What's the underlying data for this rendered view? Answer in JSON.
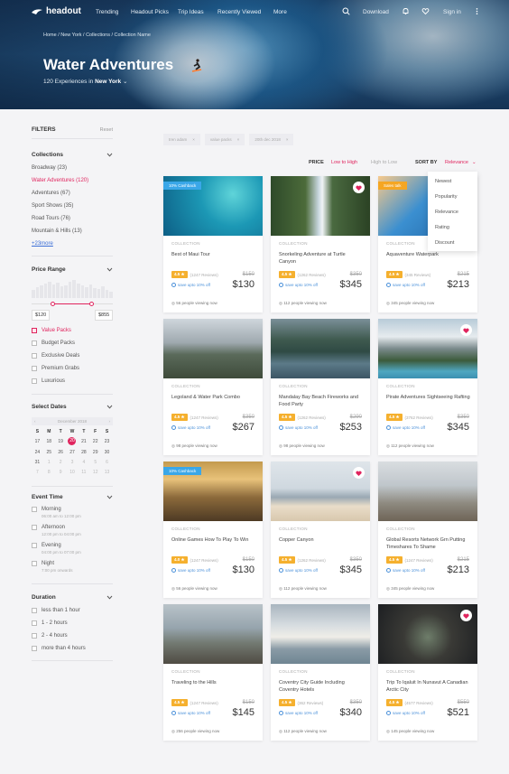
{
  "nav": {
    "brand": "headout",
    "items": [
      "Trending",
      "Headout Picks",
      "Trip Ideas",
      "Recently Viewed",
      "More"
    ],
    "download": "Download",
    "signin": "Sign in"
  },
  "hero": {
    "breadcrumb": "Home / New York / Collections / Collection Name",
    "title": "Water Adventures",
    "subtitle_prefix": "120 Experiences in",
    "city": "New York"
  },
  "filters": {
    "title": "FILTERS",
    "reset": "Reset",
    "collections_title": "Collections",
    "collections": [
      {
        "label": "Broadway (23)",
        "active": false
      },
      {
        "label": "Water Adventures (120)",
        "active": true
      },
      {
        "label": "Adventures (67)",
        "active": false
      },
      {
        "label": "Sport Shows (35)",
        "active": false
      },
      {
        "label": "Road Tours (76)",
        "active": false
      },
      {
        "label": "Mountain & Hills (13)",
        "active": false
      }
    ],
    "more": "+23more",
    "price_title": "Price Range",
    "price_min": "$120",
    "price_max": "$855",
    "price_histogram": [
      0.45,
      0.6,
      0.7,
      0.8,
      0.9,
      0.75,
      0.85,
      0.65,
      0.7,
      0.9,
      1.0,
      0.8,
      0.7,
      0.6,
      0.75,
      0.55,
      0.5,
      0.65,
      0.45,
      0.35
    ],
    "packs": [
      {
        "label": "Value Packs",
        "checked": true
      },
      {
        "label": "Budget Packs",
        "checked": false
      },
      {
        "label": "Exclusive Deals",
        "checked": false
      },
      {
        "label": "Premium Grabs",
        "checked": false
      },
      {
        "label": "Luxurious",
        "checked": false
      }
    ],
    "dates_title": "Select Dates",
    "calendar_month": "December 2018",
    "weekdays": [
      "S",
      "M",
      "T",
      "W",
      "T",
      "F",
      "S"
    ],
    "days": [
      {
        "d": "17",
        "s": "d"
      },
      {
        "d": "18",
        "s": "d"
      },
      {
        "d": "19",
        "s": "d"
      },
      {
        "d": "20",
        "s": "sel"
      },
      {
        "d": "21",
        "s": "d"
      },
      {
        "d": "22",
        "s": "d"
      },
      {
        "d": "23",
        "s": "d"
      },
      {
        "d": "24",
        "s": "d"
      },
      {
        "d": "25",
        "s": "d"
      },
      {
        "d": "26",
        "s": "d"
      },
      {
        "d": "27",
        "s": "d"
      },
      {
        "d": "28",
        "s": "d"
      },
      {
        "d": "29",
        "s": "d"
      },
      {
        "d": "30",
        "s": "d"
      },
      {
        "d": "31",
        "s": "d"
      },
      {
        "d": "1",
        "s": "dim"
      },
      {
        "d": "2",
        "s": "dim"
      },
      {
        "d": "3",
        "s": "dim"
      },
      {
        "d": "4",
        "s": "dim"
      },
      {
        "d": "5",
        "s": "dim"
      },
      {
        "d": "6",
        "s": "dim"
      },
      {
        "d": "7",
        "s": "dim"
      },
      {
        "d": "8",
        "s": "dim"
      },
      {
        "d": "9",
        "s": "dim"
      },
      {
        "d": "10",
        "s": "dim"
      },
      {
        "d": "11",
        "s": "dim"
      },
      {
        "d": "12",
        "s": "dim"
      },
      {
        "d": "13",
        "s": "dim"
      }
    ],
    "event_title": "Event Time",
    "events": [
      {
        "label": "Morning",
        "time": "06:00 am to 12:00 pm"
      },
      {
        "label": "Afternoon",
        "time": "12:00 pm to 04:00 pm"
      },
      {
        "label": "Evening",
        "time": "04:00 pm to 07:00 pm"
      },
      {
        "label": "Night",
        "time": "7:00 pm onwards"
      }
    ],
    "duration_title": "Duration",
    "durations": [
      "less than 1 hour",
      "1 - 2 hours",
      "2 - 4 hours",
      "more than 4 hours"
    ]
  },
  "tags": [
    "tren adam",
    "value packs",
    "20th dec 2018"
  ],
  "sort": {
    "price_label": "PRICE",
    "low_high": "Low to High",
    "high_low": "High to Low",
    "sortby_label": "SORT BY",
    "selected": "Relevance",
    "options": [
      "Newest",
      "Popularity",
      "Relevance",
      "Rating",
      "Discount"
    ]
  },
  "cards": [
    {
      "label": "COLLECTION",
      "title": "Best of Maui Tour",
      "rating": "4.5 ★",
      "reviews": "(1247 Reviews)",
      "save": "save upto 10% off",
      "old": "$150",
      "price": "$130",
      "viewing": "56 people viewing now",
      "badge": "10% Cashback",
      "badge_color": "blue",
      "heart": false,
      "img": "sea"
    },
    {
      "label": "COLLECTION",
      "title": "Snorkeling Adventure at Turtle Canyon",
      "rating": "4.5 ★",
      "reviews": "(1262 Reviews)",
      "save": "save upto 10% off",
      "old": "$350",
      "price": "$345",
      "viewing": "112 people viewing now",
      "badge": "",
      "badge_color": "",
      "heart": true,
      "img": "waterfall"
    },
    {
      "label": "COLLECTION",
      "title": "Aquaventure Waterpark",
      "rating": "4.5 ★",
      "reviews": "(345 Reviews)",
      "save": "save upto 10% off",
      "old": "$215",
      "price": "$213",
      "viewing": "345 people viewing now",
      "badge": "Sales talk",
      "badge_color": "orange",
      "heart": false,
      "img": "person"
    },
    {
      "label": "COLLECTION",
      "title": "Legoland & Water Park Combo",
      "rating": "4.5 ★",
      "reviews": "(1247 Reviews)",
      "save": "save upto 10% off",
      "old": "$350",
      "price": "$267",
      "viewing": "98 people viewing now",
      "badge": "",
      "badge_color": "",
      "heart": false,
      "img": "hiker"
    },
    {
      "label": "COLLECTION",
      "title": "Mandalay Bay Beach Fireworks and Food Party",
      "rating": "4.5 ★",
      "reviews": "(1262 Reviews)",
      "save": "save upto 10% off",
      "old": "$290",
      "price": "$253",
      "viewing": "98 people viewing now",
      "badge": "",
      "badge_color": "",
      "heart": false,
      "img": "lake"
    },
    {
      "label": "COLLECTION",
      "title": "Pirate Adventures Sightseeing Rafting",
      "rating": "4.5 ★",
      "reviews": "(3762 Reviews)",
      "save": "save upto 10% off",
      "old": "$350",
      "price": "$345",
      "viewing": "112 people viewing now",
      "badge": "",
      "badge_color": "",
      "heart": true,
      "img": "mountain"
    },
    {
      "label": "COLLECTION",
      "title": "Online Games How To Play To Win",
      "rating": "4.0 ★",
      "reviews": "(1247 Reviews)",
      "save": "save upto 10% off",
      "old": "$150",
      "price": "$130",
      "viewing": "56 people viewing now",
      "badge": "10% Cashback",
      "badge_color": "blue",
      "heart": false,
      "img": "station"
    },
    {
      "label": "COLLECTION",
      "title": "Copper Canyon",
      "rating": "4.5 ★",
      "reviews": "(1262 Reviews)",
      "save": "save upto 10% off",
      "old": "$350",
      "price": "$345",
      "viewing": "112 people viewing now",
      "badge": "",
      "badge_color": "",
      "heart": true,
      "img": "beach"
    },
    {
      "label": "COLLECTION",
      "title": "Global Resorts Network Grn Putting Timeshares To Shame",
      "rating": "4.5 ★",
      "reviews": "(1247 Reviews)",
      "save": "save upto 10% off",
      "old": "$215",
      "price": "$213",
      "viewing": "345 people viewing now",
      "badge": "",
      "badge_color": "",
      "heart": false,
      "img": "bridge"
    },
    {
      "label": "COLLECTION",
      "title": "Traveling to the Hills",
      "rating": "4.5 ★",
      "reviews": "(1247 Reviews)",
      "save": "save upto 10% off",
      "old": "$150",
      "price": "$145",
      "viewing": "256 people viewing now",
      "badge": "",
      "badge_color": "",
      "heart": false,
      "img": "moto"
    },
    {
      "label": "COLLECTION",
      "title": "Coventry City Guide Including Coventry Hotels",
      "rating": "4.5 ★",
      "reviews": "(362 Reviews)",
      "save": "save upto 10% off",
      "old": "$350",
      "price": "$340",
      "viewing": "112 people viewing now",
      "badge": "",
      "badge_color": "",
      "heart": false,
      "img": "ship"
    },
    {
      "label": "COLLECTION",
      "title": "Trip To Iqaluit In Nunavut A Canadian Arctic City",
      "rating": "4.5 ★",
      "reviews": "(4577 Reviews)",
      "save": "save upto 10% off",
      "old": "$550",
      "price": "$521",
      "viewing": "145 people viewing now",
      "badge": "",
      "badge_color": "",
      "heart": true,
      "img": "food"
    }
  ],
  "colors": {
    "accent": "#e0245e",
    "link": "#3c6fd6",
    "rating": "#f5b02e",
    "cashback": "#3aa7e8"
  }
}
